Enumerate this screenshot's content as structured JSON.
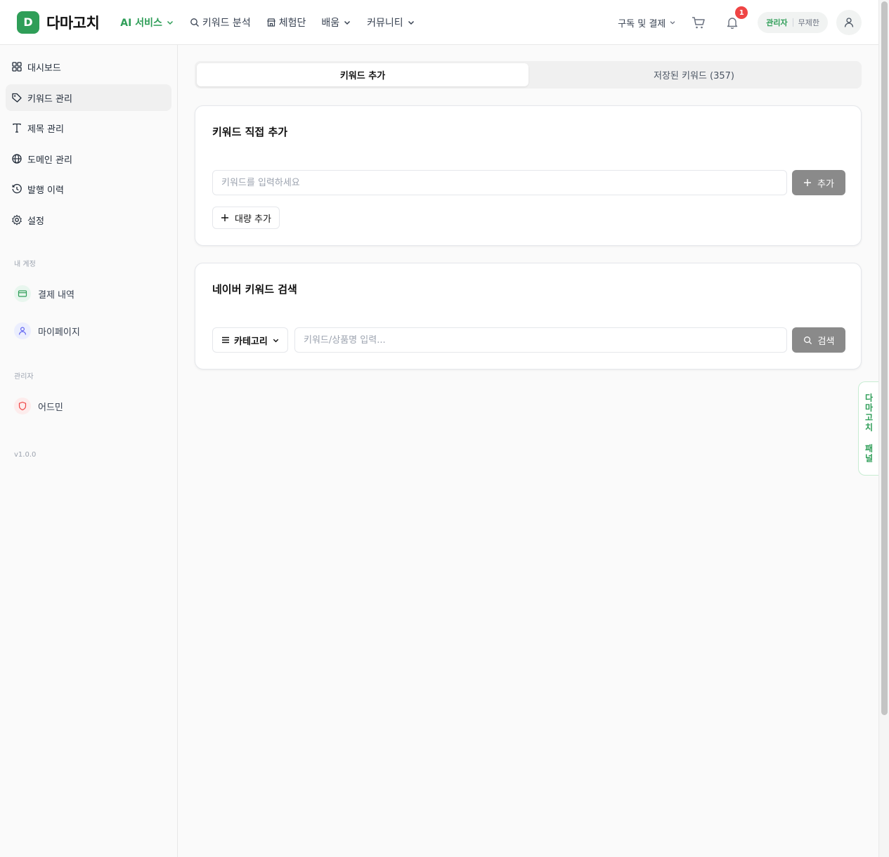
{
  "header": {
    "logo_letter": "D",
    "logo_text": "다마고치",
    "nav": {
      "ai_services": "AI 서비스",
      "keyword_analysis": "키워드 분석",
      "experience_group": "체험단",
      "learning": "배움",
      "community": "커뮤니티"
    },
    "subscription_link": "구독 및 결제",
    "notification_count": "1",
    "role": "관리자",
    "plan": "무제한"
  },
  "sidebar": {
    "items": [
      {
        "label": "대시보드"
      },
      {
        "label": "키워드 관리"
      },
      {
        "label": "제목 관리"
      },
      {
        "label": "도메인 관리"
      },
      {
        "label": "발행 이력"
      },
      {
        "label": "설정"
      }
    ],
    "account_section_title": "내 계정",
    "account_items": [
      {
        "label": "결제 내역"
      },
      {
        "label": "마이페이지"
      }
    ],
    "admin_section_title": "관리자",
    "admin_items": [
      {
        "label": "어드민"
      }
    ],
    "version": "v1.0.0"
  },
  "tabs": {
    "add_keyword": "키워드 추가",
    "saved_keywords": "저장된 키워드 (357)"
  },
  "direct_add": {
    "title": "키워드 직접 추가",
    "input_placeholder": "키워드를 입력하세요",
    "add_button": "추가",
    "bulk_add_button": "대량 추가"
  },
  "naver_search": {
    "title": "네이버 키워드 검색",
    "category_button": "카테고리",
    "input_placeholder": "키워드/상품명 입력...",
    "search_button": "검색"
  },
  "side_panel_label": "다마고치 패널",
  "colors": {
    "brand": "#2f9e58",
    "button_gray": "#8a8a8a",
    "badge_red": "#ef4444"
  }
}
